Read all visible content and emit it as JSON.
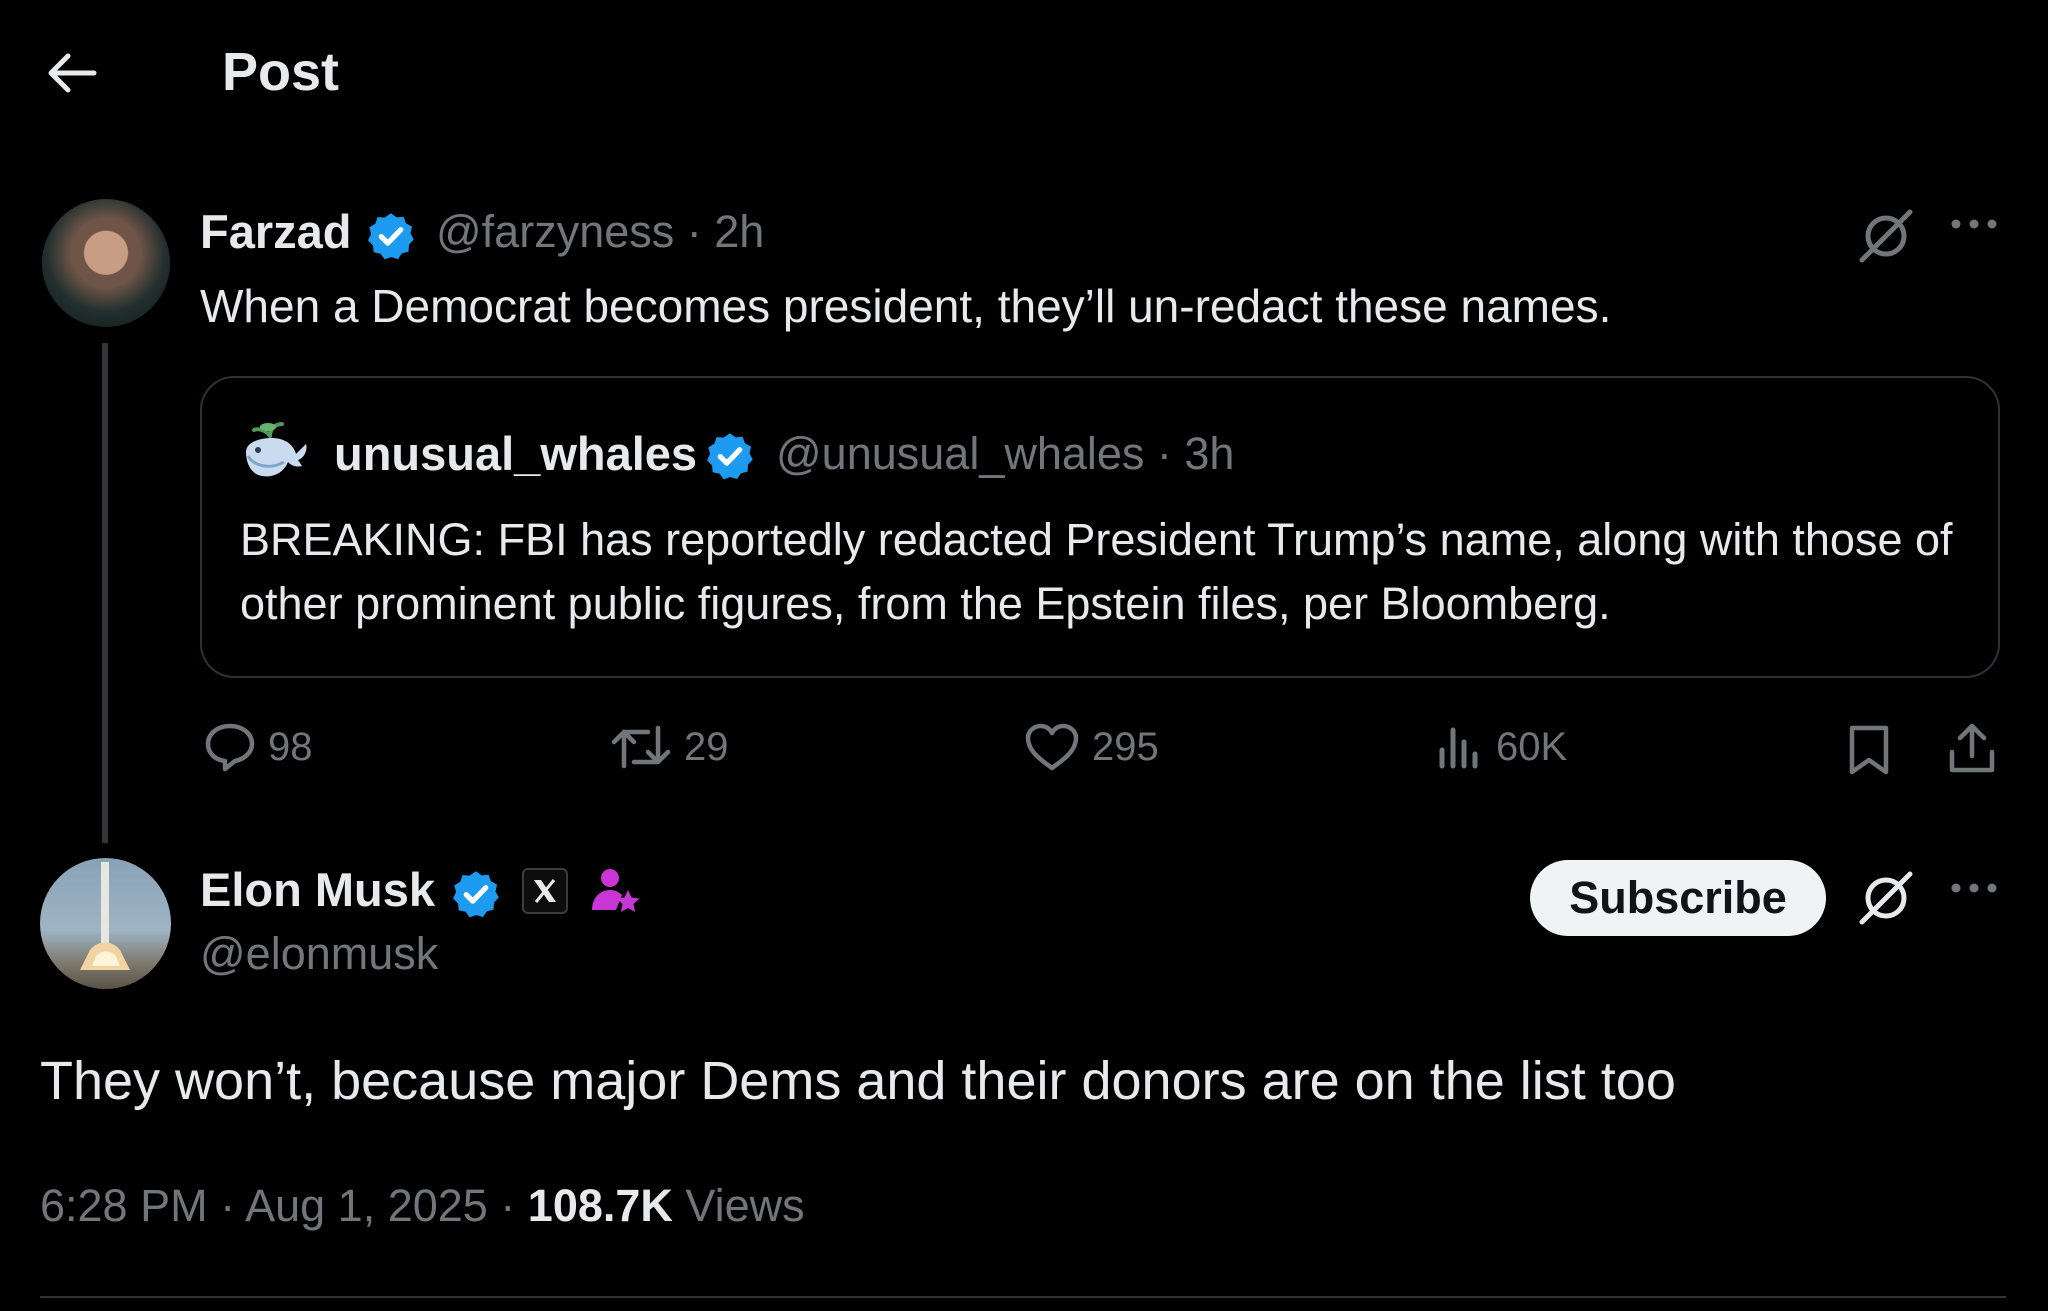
{
  "header": {
    "title": "Post"
  },
  "original_post": {
    "author_name": "Farzad",
    "author_handle": "@farzyness",
    "time": "2h",
    "handle_time": "@farzyness · 2h",
    "text": "When a Democrat becomes president, they’ll un-redact these names.",
    "quoted_post": {
      "author_name": "unusual_whales",
      "handle_time": "@unusual_whales · 3h",
      "text": "BREAKING: FBI has reportedly redacted President Trump’s name, along with those of other prominent public figures, from the Epstein files, per Bloomberg."
    },
    "stats": {
      "replies": "98",
      "reposts": "29",
      "likes": "295",
      "views": "60K"
    }
  },
  "reply_post": {
    "author_name": "Elon Musk",
    "author_handle": "@elonmusk",
    "subscribe_label": "Subscribe",
    "text": "They won’t, because major Dems and their donors are on the list too",
    "time_date": "6:28 PM · Aug 1, 2025 · ",
    "views_count": "108.7K",
    "views_label": " Views"
  },
  "colors": {
    "background": "#000000",
    "primary_text": "#e7e9ea",
    "secondary_text": "#71767b",
    "verified_blue": "#1d9bf0",
    "affiliate_pink": "#c936d6",
    "border": "#2f3336"
  },
  "icons": [
    "back-arrow-icon",
    "verified-badge-icon",
    "grok-icon",
    "more-icon",
    "reply-icon",
    "repost-icon",
    "like-icon",
    "views-icon",
    "bookmark-icon",
    "share-icon",
    "x-logo-icon",
    "affiliate-icon"
  ]
}
